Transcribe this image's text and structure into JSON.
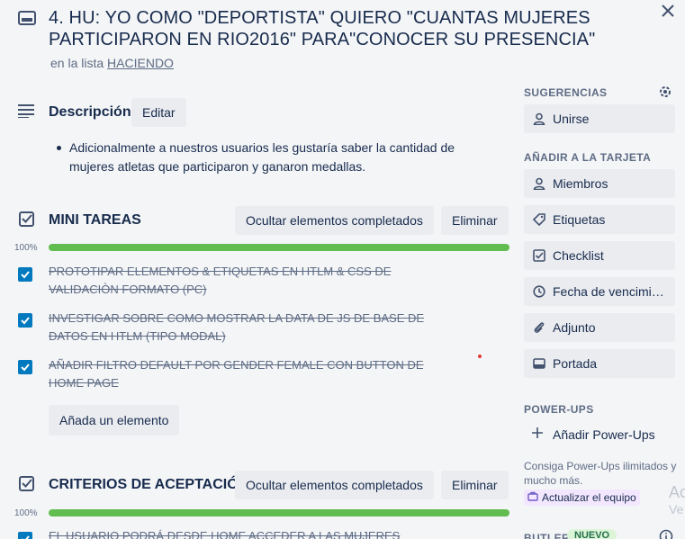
{
  "card": {
    "title": "4. HU: YO COMO \"DEPORTISTA\" QUIERO \"CUANTAS MUJERES PARTICIPARON EN RIO2016\" PARA\"CONOCER SU PRESENCIA\"",
    "in_list_prefix": "en la lista",
    "list_name": "HACIENDO"
  },
  "description": {
    "heading": "Descripción",
    "edit_label": "Editar",
    "text": "Adicionalmente a nuestros usuarios les gustaría saber la cantidad de mujeres atletas que participaron y ganaron medallas."
  },
  "checklists": [
    {
      "title": "MINI TAREAS",
      "hide_label": "Ocultar elementos completados",
      "delete_label": "Eliminar",
      "progress_label": "100%",
      "progress": 1.0,
      "items": [
        {
          "text": "PROTOTIPAR ELEMENTOS & ETIQUETAS EN HTLM & CSS DE VALIDACIÒN FORMATO (PC)",
          "checked": true
        },
        {
          "text": "INVESTIGAR SOBRE COMO MOSTRAR LA DATA DE JS DE BASE DE DATOS EN HTLM (TIPO MODAL)",
          "checked": true
        },
        {
          "text": "AÑADIR FILTRO DEFAULT POR GENDER FEMALE CON BUTTON DE HOME PAGE",
          "checked": true
        }
      ],
      "add_label": "Añada un elemento"
    },
    {
      "title": "CRITERIOS DE ACEPTACIÓN",
      "hide_label": "Ocultar elementos completados",
      "delete_label": "Eliminar",
      "progress_label": "100%",
      "progress": 1.0,
      "items": [
        {
          "text": "EL USUARIO PODRÁ DESDE HOME ACCEDER A LAS MUJERES",
          "checked": true
        }
      ]
    }
  ],
  "sidebar": {
    "suggestions_heading": "SUGERENCIAS",
    "join_label": "Unirse",
    "add_to_card_heading": "AÑADIR A LA TARJETA",
    "add_items": [
      {
        "label": "Miembros",
        "icon": "person-icon"
      },
      {
        "label": "Etiquetas",
        "icon": "tag-icon"
      },
      {
        "label": "Checklist",
        "icon": "checklist-icon"
      },
      {
        "label": "Fecha de vencimiento",
        "icon": "clock-icon"
      },
      {
        "label": "Adjunto",
        "icon": "paperclip-icon"
      },
      {
        "label": "Portada",
        "icon": "cover-icon"
      }
    ],
    "powerups_heading": "POWER-UPS",
    "add_powerups_label": "Añadir Power-Ups",
    "powerups_note": "Consiga Power-Ups ilimitados y mucho más.",
    "upgrade_label": "Actualizar el equipo",
    "butler_heading": "BUTLER",
    "butler_badge": "NUEVO"
  },
  "watermark": {
    "line1": "Ac",
    "line2": "Ve"
  },
  "colors": {
    "accent": "#0079bf",
    "progress_green": "#61bd4f",
    "background": "#f4f5f7",
    "button_bg": "#ebecf0"
  }
}
